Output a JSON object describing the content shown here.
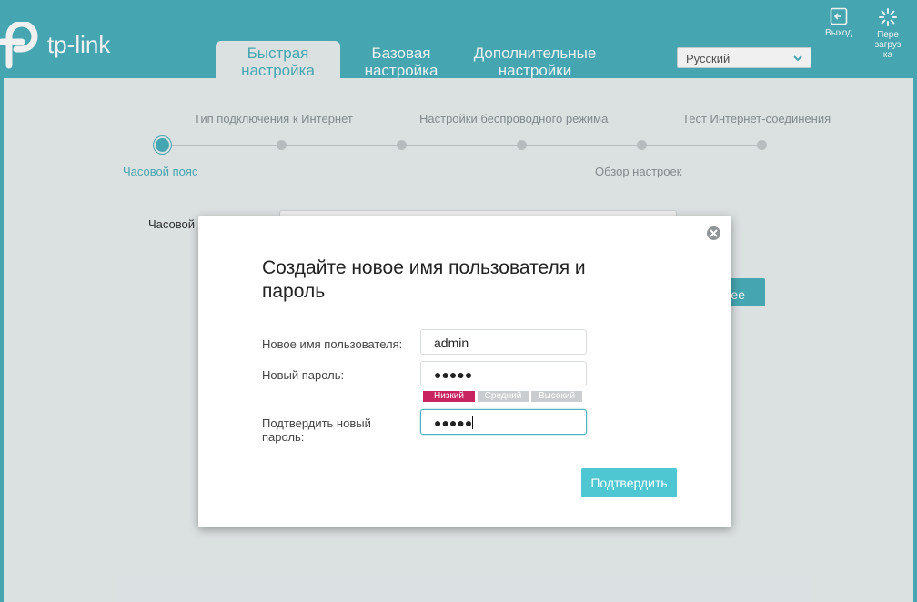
{
  "header": {
    "logo_text": "tp-link",
    "tabs": [
      {
        "line1": "Быстрая",
        "line2": "настройка",
        "active": true
      },
      {
        "line1": "Базовая",
        "line2": "настройка",
        "active": false
      },
      {
        "line1": "Дополнительные",
        "line2": "настройки",
        "active": false
      }
    ],
    "language": "Русский",
    "logout_label": "Выход",
    "reboot_label_lines": [
      "Пере",
      "загруз",
      "ка"
    ],
    "icons": {
      "logout": "logout-icon",
      "reboot": "reboot-icon",
      "chevron": "chevron-down-icon"
    }
  },
  "wizard": {
    "steps_top": [
      "Тип подключения к Интернет",
      "Настройки беспроводного режима",
      "Тест Интернет-соединения"
    ],
    "steps_bottom": [
      "Часовой пояс",
      "Обзор настроек"
    ],
    "active_step": "Часовой пояс",
    "field_label": "Часовой",
    "next_button_partial": "ее"
  },
  "modal": {
    "title": "Создайте новое имя пользователя и пароль",
    "username_label": "Новое имя пользователя:",
    "username_value": "admin",
    "password_label": "Новый пароль:",
    "password_value": "●●●●●",
    "strength": {
      "low": "Низкий",
      "medium": "Средний",
      "high": "Высокий",
      "current": "low"
    },
    "confirm_label_lines": [
      "Подтвердить новый",
      "пароль:"
    ],
    "confirm_value": "●●●●●",
    "confirm_button": "Подтвердить",
    "close_icon": "close-icon"
  },
  "colors": {
    "brand": "#4ab1bd",
    "button": "#4ec7d3",
    "strength_low": "#c8245f",
    "panel": "#e9eef0"
  }
}
